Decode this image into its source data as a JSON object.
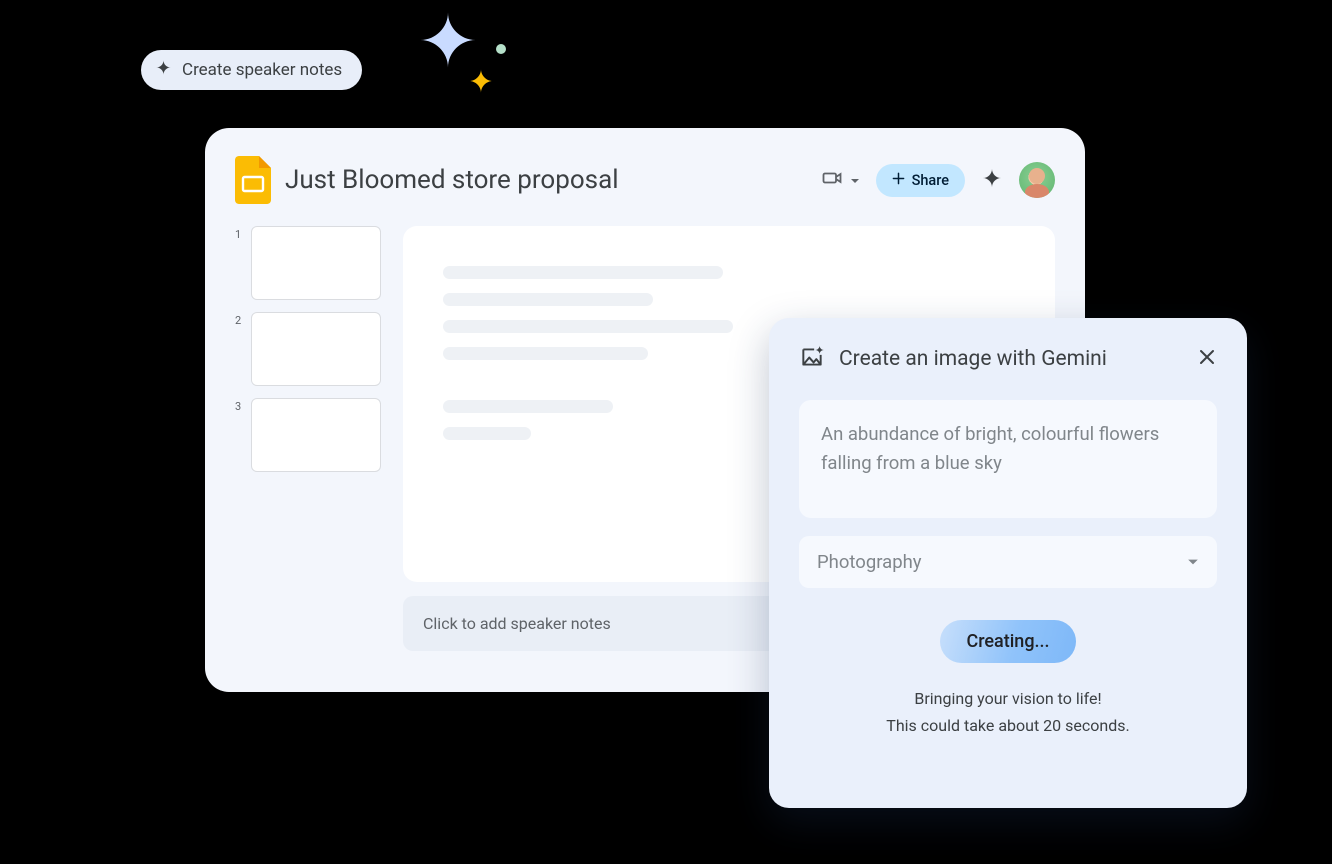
{
  "chip": {
    "label": "Create speaker notes"
  },
  "slides": {
    "title": "Just Bloomed store proposal",
    "share_label": "Share",
    "thumbs": [
      "1",
      "2",
      "3"
    ],
    "speaker_notes_placeholder": "Click to add speaker notes"
  },
  "gemini": {
    "title": "Create an image with Gemini",
    "prompt_value": "An abundance of bright, colourful flowers falling from a blue sky",
    "style_value": "Photography",
    "button_label": "Creating...",
    "status_line1": "Bringing your vision to life!",
    "status_line2": "This could take about 20 seconds."
  }
}
